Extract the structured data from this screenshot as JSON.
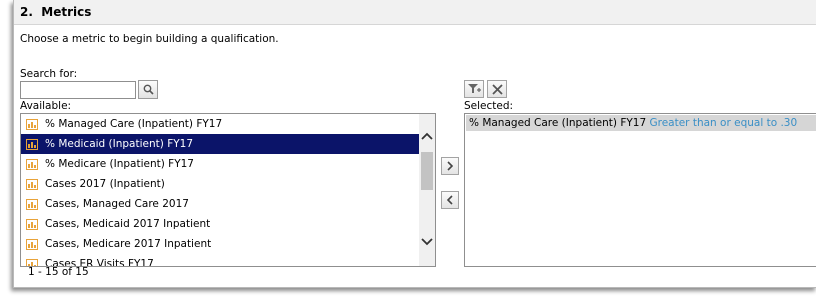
{
  "section": {
    "number": "2.",
    "title": "Metrics"
  },
  "intro_text": "Choose a metric to begin building a qualification.",
  "search": {
    "label": "Search for:",
    "value": "",
    "button_icon": "search-icon"
  },
  "available": {
    "label": "Available:",
    "items": [
      {
        "label": "% Managed Care (Inpatient) FY17",
        "selected": false
      },
      {
        "label": "% Medicaid (Inpatient) FY17",
        "selected": true
      },
      {
        "label": "% Medicare (Inpatient) FY17",
        "selected": false
      },
      {
        "label": "Cases 2017 (Inpatient)",
        "selected": false
      },
      {
        "label": "Cases, Managed Care 2017",
        "selected": false
      },
      {
        "label": "Cases, Medicaid 2017 Inpatient",
        "selected": false
      },
      {
        "label": "Cases, Medicare 2017 Inpatient",
        "selected": false
      },
      {
        "label": "Cases ER Visits FY17",
        "selected": false
      }
    ],
    "count_text": "1 - 15 of 15"
  },
  "controls": {
    "add_icon": "chevron-right-icon",
    "remove_icon": "chevron-left-icon",
    "filter_icon": "filter-add-icon",
    "clear_icon": "clear-x-icon"
  },
  "selected": {
    "label": "Selected:",
    "items": [
      {
        "metric": "% Managed Care (Inpatient) FY17",
        "condition": "Greater than or equal to .30"
      }
    ]
  },
  "colors": {
    "selection_bg": "#0b1469",
    "condition_text": "#3a8fc6",
    "metric_icon": "#e8a33a"
  }
}
